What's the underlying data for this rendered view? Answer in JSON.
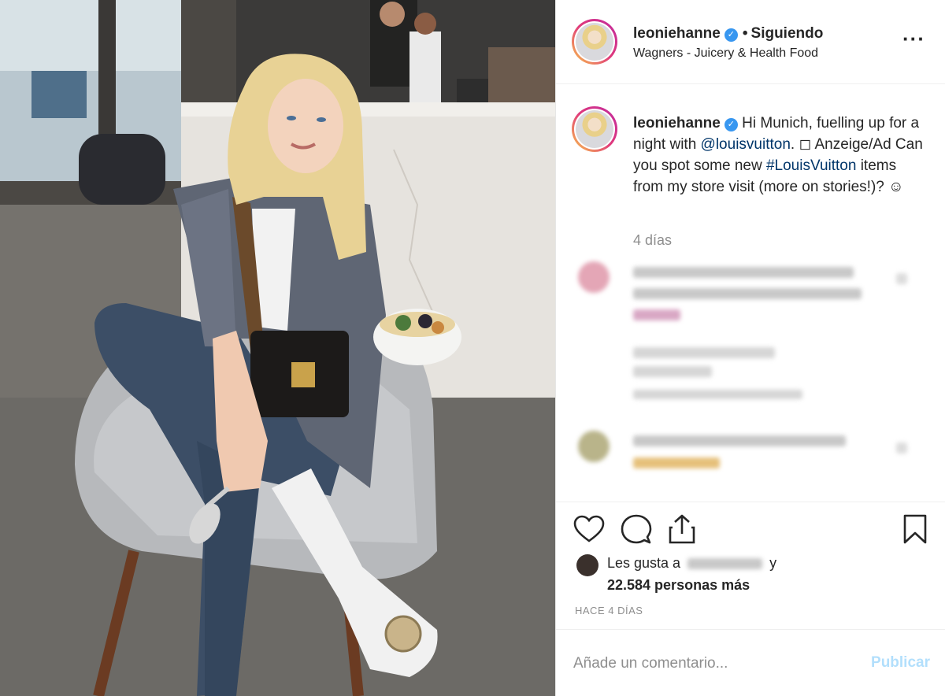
{
  "post": {
    "username": "leoniehanne",
    "verified_mark": "✓",
    "separator": "•",
    "follow_status": "Siguiendo",
    "location": "Wagners - Juicery & Health Food",
    "more_icon": "more-horizontal-icon"
  },
  "caption": {
    "part1": "Hi Munich, fuelling up for a night with ",
    "mention": "@louisvuitton",
    "part2": ". ◻ Anzeige/Ad Can you spot some new ",
    "hashtag": "#LouisVuitton",
    "part3": " items from my store visit (more on stories!)? ☺",
    "age": "4 días"
  },
  "likes": {
    "prefix": "Les gusta a",
    "suffix": "y",
    "count_text": "22.584 personas más"
  },
  "timestamp": "HACE 4 DÍAS",
  "comment": {
    "placeholder": "Añade un comentario...",
    "publish_label": "Publicar"
  },
  "colors": {
    "link": "#003569",
    "verified": "#3897f0",
    "publish_disabled": "#b2dffc",
    "muted": "#8e8e8e"
  }
}
